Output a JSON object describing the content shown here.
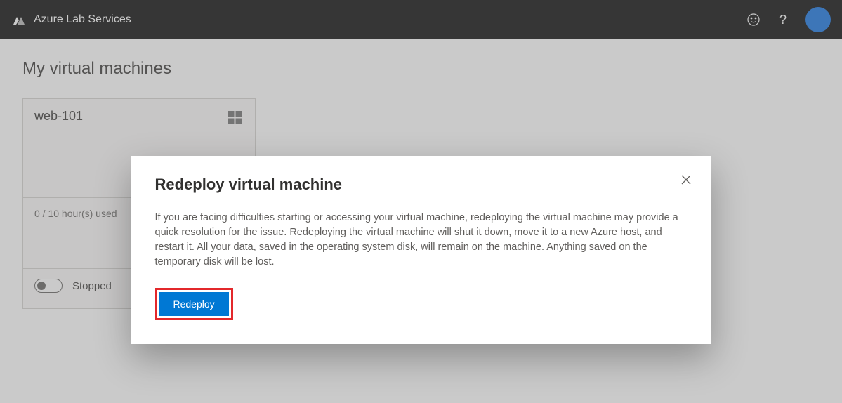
{
  "topbar": {
    "brand": "Azure Lab Services",
    "help_label": "?",
    "avatar_color": "#0d6ee1"
  },
  "page": {
    "title": "My virtual machines"
  },
  "vm_card": {
    "name": "web-101",
    "os_icon": "windows-icon",
    "hours_used": "0 / 10 hour(s) used",
    "status": "Stopped"
  },
  "dialog": {
    "title": "Redeploy virtual machine",
    "body": "If you are facing difficulties starting or accessing your virtual machine, redeploying the virtual machine may provide a quick resolution for the issue. Redeploying the virtual machine will shut it down, move it to a new Azure host, and restart it. All your data, saved in the operating system disk, will remain on the machine. Anything saved on the temporary disk will be lost.",
    "redeploy_label": "Redeploy"
  }
}
